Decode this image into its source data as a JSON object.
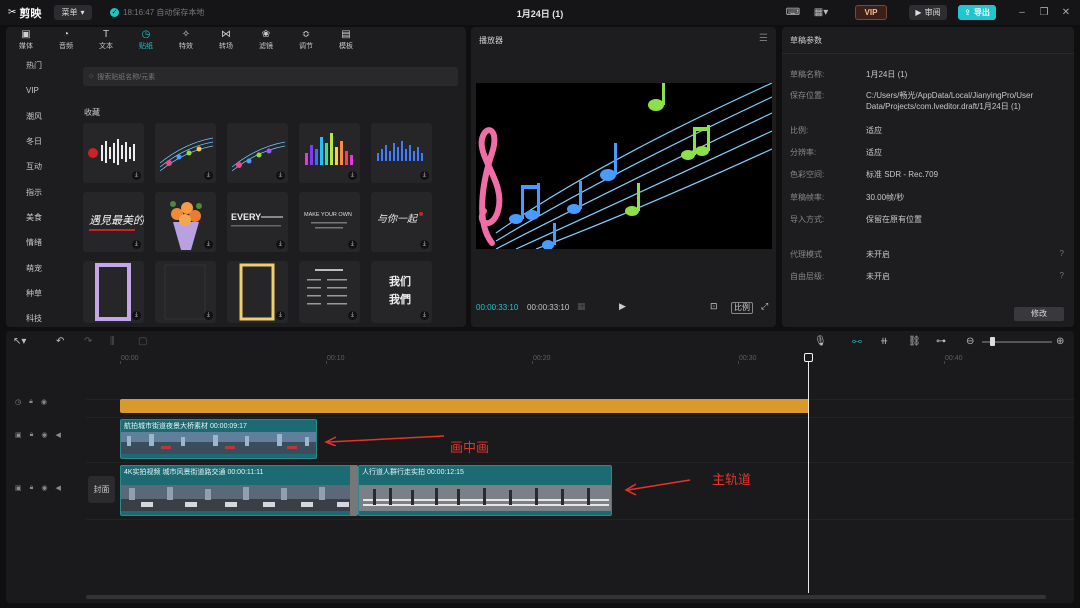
{
  "titlebar": {
    "app_name": "剪映",
    "menu_label": "菜单",
    "save_status": "18:16:47 自动保存本地",
    "project_title": "1月24日 (1)",
    "vip_label": "VIP",
    "review_label": "审阅",
    "export_label": "导出"
  },
  "media": {
    "tabs": [
      {
        "label": "媒体",
        "icon": "media-icon",
        "glyph": "▣"
      },
      {
        "label": "音频",
        "icon": "audio-icon",
        "glyph": "◔"
      },
      {
        "label": "文本",
        "icon": "text-icon",
        "glyph": "T"
      },
      {
        "label": "贴纸",
        "icon": "sticker-icon",
        "glyph": "◷"
      },
      {
        "label": "特效",
        "icon": "effect-icon",
        "glyph": "✧"
      },
      {
        "label": "转场",
        "icon": "transition-icon",
        "glyph": "⋈"
      },
      {
        "label": "滤镜",
        "icon": "filter-icon",
        "glyph": "❀"
      },
      {
        "label": "调节",
        "icon": "adjust-icon",
        "glyph": "≎"
      },
      {
        "label": "模板",
        "icon": "template-icon",
        "glyph": "▤"
      }
    ],
    "active_tab": "贴纸",
    "categories": [
      "热门",
      "VIP",
      "潮风",
      "冬日",
      "互动",
      "指示",
      "美食",
      "情绪",
      "萌宠",
      "种草",
      "科技"
    ],
    "search_placeholder": "搜索贴纸名称/元素",
    "section_label": "收藏",
    "sticker_text": {
      "row2_1": "遇見最美的你",
      "row2_3": "EVERY",
      "row2_4": "MAKE YOUR OWN",
      "row2_5": "与你一起",
      "row3_4": "我们",
      "row3_5": "我們"
    }
  },
  "player": {
    "title": "播放器",
    "current_time": "00:00:33:10",
    "total_time": "00:00:33:10",
    "ratio_label": "比例"
  },
  "draft": {
    "title": "草稿参数",
    "params": [
      {
        "label": "草稿名称:",
        "value": "1月24日 (1)"
      },
      {
        "label": "保存位置:",
        "value": "C:/Users/畅光/AppData/Local/JianyingPro/User Data/Projects/com.lveditor.draft/1月24日 (1)"
      },
      {
        "label": "比例:",
        "value": "适应"
      },
      {
        "label": "分辨率:",
        "value": "适应"
      },
      {
        "label": "色彩空间:",
        "value": "标准 SDR - Rec.709"
      },
      {
        "label": "草稿帧率:",
        "value": "30.00帧/秒"
      },
      {
        "label": "导入方式:",
        "value": "保留在原有位置"
      },
      {
        "label": "代理模式",
        "value": "未开启"
      },
      {
        "label": "自由层级:",
        "value": "未开启"
      }
    ],
    "modify_label": "修改"
  },
  "timeline": {
    "ruler_labels": [
      "00:00",
      "00:10",
      "00:20",
      "00:30",
      "00:40"
    ],
    "cover_label": "封面",
    "pip_clip_label": "航拍城市街道夜景大桥素材  00:00:09:17",
    "main_clip1_label": "4K实拍视频 城市风景街道路交通  00:00:11:11",
    "main_clip2_label": "人行道人群行走实拍  00:00:12:15",
    "annotation_pip": "画中画",
    "annotation_main": "主轨道"
  },
  "colors": {
    "accent": "#1fc5cf",
    "sticker_track": "#d99a2b",
    "clip": "#1c6b72",
    "annotation": "#e8322a"
  }
}
